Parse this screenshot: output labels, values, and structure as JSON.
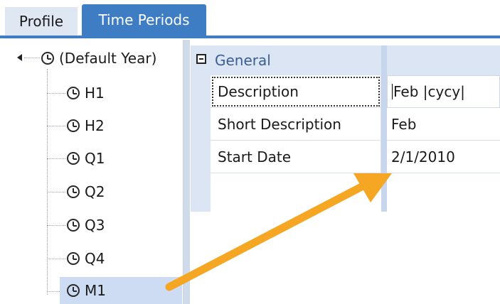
{
  "tabs": [
    {
      "label": "Profile",
      "active": false
    },
    {
      "label": "Time Periods",
      "active": true
    }
  ],
  "tree": {
    "root": {
      "label": "(Default Year)",
      "icon": "clock-icon",
      "expanded": true
    },
    "children": [
      {
        "label": "H1",
        "icon": "clock-icon",
        "selected": false
      },
      {
        "label": "H2",
        "icon": "clock-icon",
        "selected": false
      },
      {
        "label": "Q1",
        "icon": "clock-icon",
        "selected": false
      },
      {
        "label": "Q2",
        "icon": "clock-icon",
        "selected": false
      },
      {
        "label": "Q3",
        "icon": "clock-icon",
        "selected": false
      },
      {
        "label": "Q4",
        "icon": "clock-icon",
        "selected": false
      },
      {
        "label": "M1",
        "icon": "clock-icon",
        "selected": true
      }
    ]
  },
  "property_grid": {
    "category": {
      "label": "General",
      "expanded": true
    },
    "properties": [
      {
        "name": "Description",
        "value": "Feb |cycy|",
        "focused": true,
        "editing": true
      },
      {
        "name": "Short Description",
        "value": "Feb",
        "focused": false,
        "editing": false
      },
      {
        "name": "Start Date",
        "value": "2/1/2010",
        "focused": false,
        "editing": false
      }
    ]
  },
  "colors": {
    "active_tab": "#3e7cc4",
    "selection": "#cddcf2",
    "category_bg": "#dbe5f4",
    "annotation_arrow": "#f5a623"
  }
}
